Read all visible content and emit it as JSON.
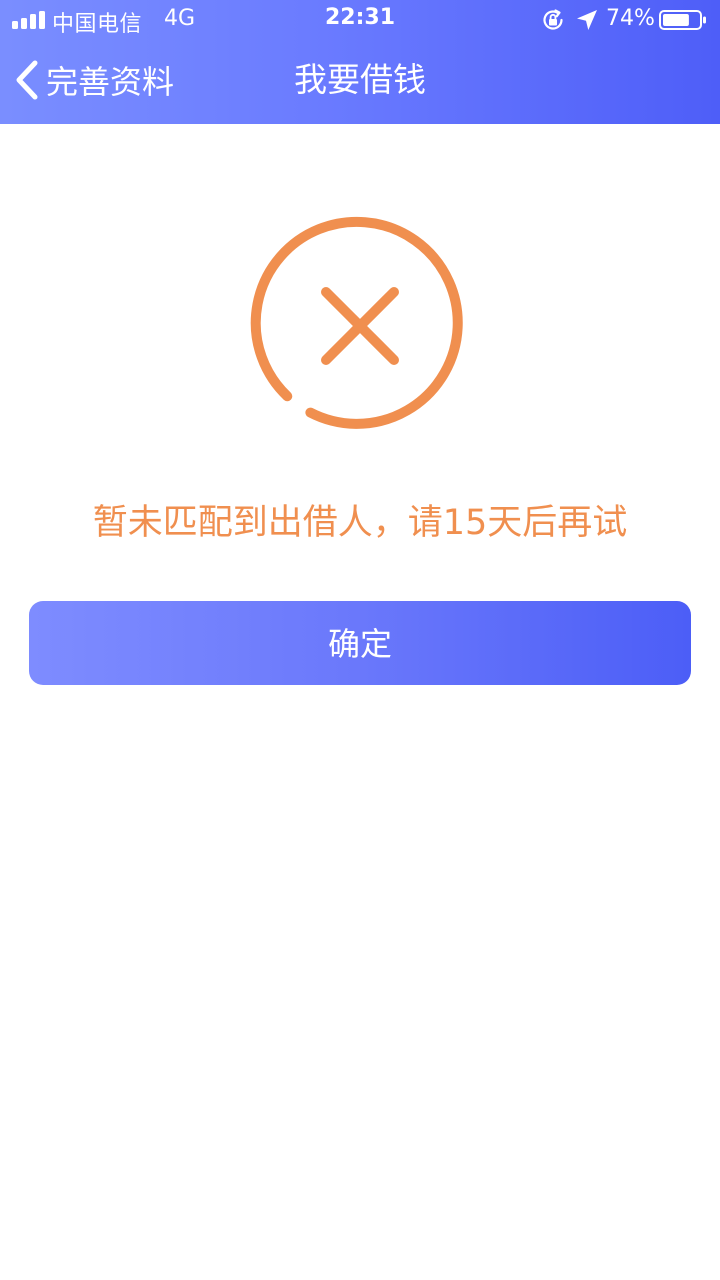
{
  "status_bar": {
    "carrier": "中国电信",
    "network": "4G",
    "time": "22:31",
    "battery_percent": "74%",
    "battery_level": 0.74,
    "icons": [
      "signal-icon",
      "rotation-lock-icon",
      "location-arrow-icon",
      "battery-icon"
    ]
  },
  "nav": {
    "back_label": "完善资料",
    "back_icon": "chevron-left-icon",
    "title": "我要借钱"
  },
  "result": {
    "icon": "error-x-circle-icon",
    "message": "暂未匹配到出借人，请15天后再试",
    "confirm_label": "确定"
  },
  "colors": {
    "header_gradient_start": "#7a8eff",
    "header_gradient_end": "#4e5ef8",
    "accent_orange": "#f08f4f",
    "button_gradient_start": "#7e8cff",
    "button_gradient_end": "#4c5ef7"
  }
}
